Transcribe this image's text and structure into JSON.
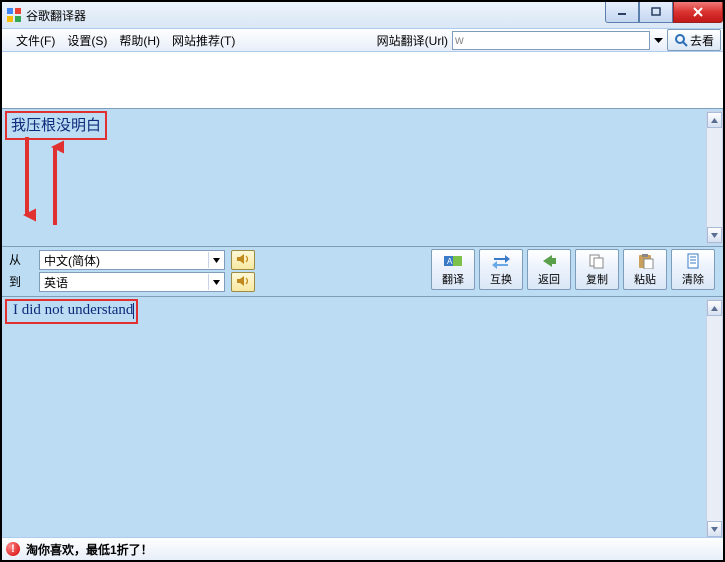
{
  "window": {
    "title": "谷歌翻译器"
  },
  "menu": {
    "file": "文件(F)",
    "settings": "设置(S)",
    "help": "帮助(H)",
    "site_recommend": "网站推荐(T)"
  },
  "url_bar": {
    "label": "网站翻译(Url)",
    "value": "w",
    "go": "去看"
  },
  "source": {
    "text": "我压根没明白"
  },
  "lang": {
    "from_label": "从",
    "to_label": "到",
    "from_value": "中文(简体)",
    "to_value": "英语"
  },
  "actions": {
    "translate": "翻译",
    "swap": "互换",
    "back": "返回",
    "copy": "复制",
    "paste": "粘贴",
    "clear": "清除"
  },
  "output": {
    "text": "I did not understand"
  },
  "status": {
    "text": "淘你喜欢，最低1折了！"
  }
}
